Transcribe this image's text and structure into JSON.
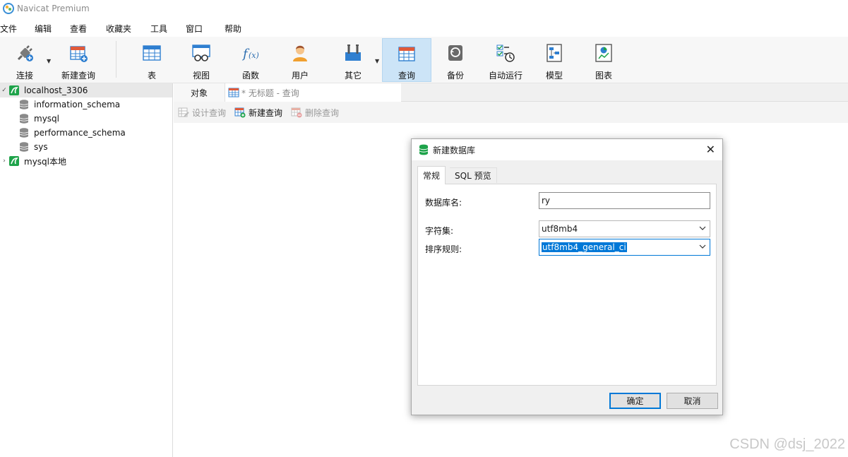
{
  "app": {
    "title": "Navicat Premium"
  },
  "menu": [
    "文件",
    "编辑",
    "查看",
    "收藏夹",
    "工具",
    "窗口",
    "帮助"
  ],
  "toolbar": {
    "connect": "连接",
    "new_query": "新建查询",
    "table": "表",
    "view": "视图",
    "function": "函数",
    "user": "用户",
    "other": "其它",
    "query": "查询",
    "backup": "备份",
    "auto_run": "自动运行",
    "model": "模型",
    "chart": "图表"
  },
  "sidebar": {
    "connections": [
      {
        "name": "localhost_3306",
        "expanded": true,
        "databases": [
          "information_schema",
          "mysql",
          "performance_schema",
          "sys"
        ]
      },
      {
        "name": "mysql本地",
        "expanded": false
      }
    ]
  },
  "tabs": {
    "objects": "对象",
    "query": "* 无标题 - 查询"
  },
  "subtoolbar": {
    "design_query": "设计查询",
    "new_query": "新建查询",
    "delete_query": "删除查询"
  },
  "dialog": {
    "title": "新建数据库",
    "tabs": [
      "常规",
      "SQL 预览"
    ],
    "fields": {
      "db_name_label": "数据库名:",
      "db_name_value": "ry",
      "charset_label": "字符集:",
      "charset_value": "utf8mb4",
      "collation_label": "排序规则:",
      "collation_value": "utf8mb4_general_ci"
    },
    "ok": "确定",
    "cancel": "取消"
  },
  "watermark": "CSDN @dsj_2022",
  "colors": {
    "accent": "#0078d7",
    "active_tool": "#cce4f7",
    "db_green": "#1ea34a"
  }
}
